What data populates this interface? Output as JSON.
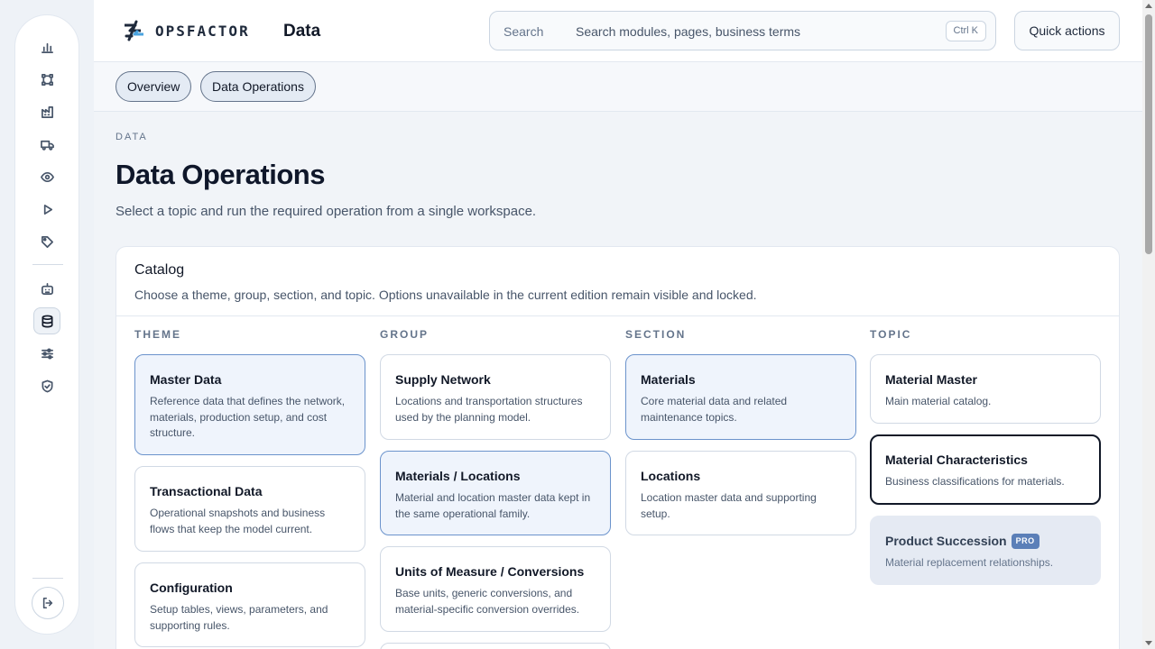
{
  "brand": {
    "name": "OPSFACTOR"
  },
  "header": {
    "section": "Data",
    "search_label": "Search",
    "search_placeholder": "Search modules, pages, business terms",
    "search_shortcut": "Ctrl K",
    "quick_actions": "Quick actions"
  },
  "tabs": [
    {
      "label": "Overview"
    },
    {
      "label": "Data Operations"
    }
  ],
  "page": {
    "crumb": "DATA",
    "title": "Data Operations",
    "subtitle": "Select a topic and run the required operation from a single workspace."
  },
  "catalog": {
    "title": "Catalog",
    "description": "Choose a theme, group, section, and topic. Options unavailable in the current edition remain visible and locked.",
    "columns": {
      "theme": {
        "heading": "THEME",
        "cards": [
          {
            "title": "Master Data",
            "desc": "Reference data that defines the network, materials, production setup, and cost structure.",
            "state": "selected"
          },
          {
            "title": "Transactional Data",
            "desc": "Operational snapshots and business flows that keep the model current."
          },
          {
            "title": "Configuration",
            "desc": "Setup tables, views, parameters, and supporting rules."
          }
        ]
      },
      "group": {
        "heading": "GROUP",
        "cards": [
          {
            "title": "Supply Network",
            "desc": "Locations and transportation structures used by the planning model."
          },
          {
            "title": "Materials / Locations",
            "desc": "Material and location master data kept in the same operational family.",
            "state": "selected"
          },
          {
            "title": "Units of Measure / Conversions",
            "desc": "Base units, generic conversions, and material-specific conversion overrides."
          }
        ]
      },
      "section": {
        "heading": "SECTION",
        "cards": [
          {
            "title": "Materials",
            "desc": "Core material data and related maintenance topics.",
            "state": "selected"
          },
          {
            "title": "Locations",
            "desc": "Location master data and supporting setup."
          }
        ]
      },
      "topic": {
        "heading": "TOPIC",
        "cards": [
          {
            "title": "Material Master",
            "desc": "Main material catalog."
          },
          {
            "title": "Material Characteristics",
            "desc": "Business classifications for materials.",
            "state": "focused"
          },
          {
            "title": "Product Succession",
            "badge": "PRO",
            "desc": "Material replacement relationships.",
            "state": "locked"
          }
        ]
      }
    }
  },
  "nav_icons": [
    "bar-chart-icon",
    "network-icon",
    "factory-icon",
    "truck-icon",
    "eye-icon",
    "play-icon",
    "tag-icon",
    "robot-icon",
    "database-icon",
    "sliders-icon",
    "shield-check-icon"
  ],
  "colors": {
    "accent": "#6b93cc",
    "selected_bg": "#eff4fc",
    "locked_bg": "#e5eaf3",
    "pro_badge": "#5b7fb8"
  }
}
